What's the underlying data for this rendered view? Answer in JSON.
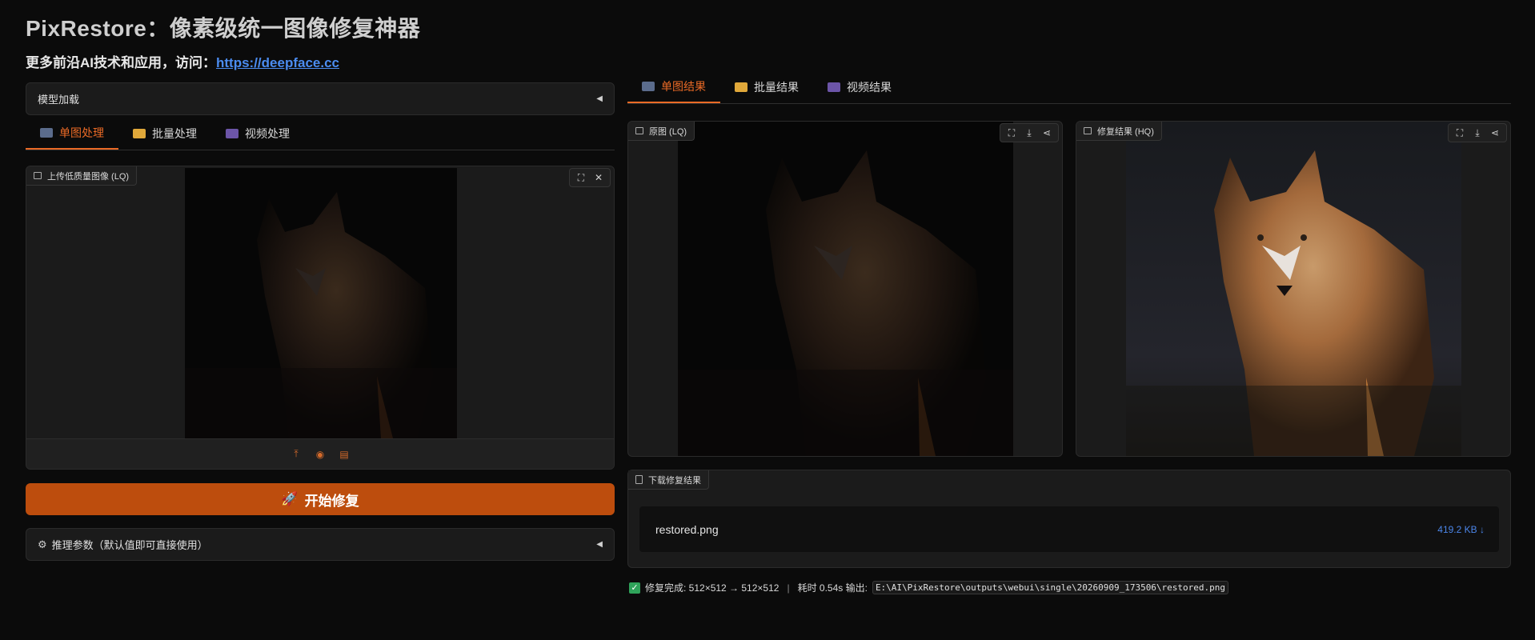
{
  "app": {
    "title": "PixRestore：像素级统一图像修复神器",
    "subtitle_prefix": "更多前沿AI技术和应用，访问：",
    "subtitle_link": "https://deepface.cc"
  },
  "left": {
    "model_accordion_label": "模型加载",
    "tabs": [
      {
        "label": "单图处理",
        "icon": "camera-icon",
        "active": true
      },
      {
        "label": "批量处理",
        "icon": "folder-icon",
        "active": false
      },
      {
        "label": "视频处理",
        "icon": "clapper-icon",
        "active": false
      }
    ],
    "upload": {
      "label": "上传低质量图像 (LQ)",
      "toolbar_icons": [
        "fullscreen-icon",
        "close-icon"
      ],
      "source_icons": [
        "upload-icon",
        "webcam-icon",
        "clipboard-icon"
      ]
    },
    "run_button_label": "开始修复",
    "run_button_icon": "rocket-icon",
    "params_accordion_label": "推理参数（默认值即可直接使用）",
    "params_icon": "gear-icon"
  },
  "right": {
    "tabs": [
      {
        "label": "单图结果",
        "icon": "camera-icon",
        "active": true
      },
      {
        "label": "批量结果",
        "icon": "folder-icon",
        "active": false
      },
      {
        "label": "视频结果",
        "icon": "clapper-icon",
        "active": false
      }
    ],
    "original": {
      "label": "原图 (LQ)",
      "toolbar_icons": [
        "fullscreen-icon",
        "download-icon",
        "share-icon"
      ]
    },
    "restored": {
      "label": "修复结果 (HQ)",
      "toolbar_icons": [
        "fullscreen-icon",
        "download-icon",
        "share-icon"
      ]
    },
    "download": {
      "label": "下载修复结果",
      "file_name": "restored.png",
      "file_size": "419.2 KB ↓"
    },
    "status": {
      "prefix": "修复完成: 512×512 → 512×512",
      "time": "耗时 0.54s 输出:",
      "path": "E:\\AI\\PixRestore\\outputs\\webui\\single\\20260909_173506\\restored.png"
    }
  },
  "colors": {
    "accent": "#ea6a26",
    "button": "#bd4d0d",
    "link": "#4b8cf0",
    "success": "#2fa35a"
  }
}
